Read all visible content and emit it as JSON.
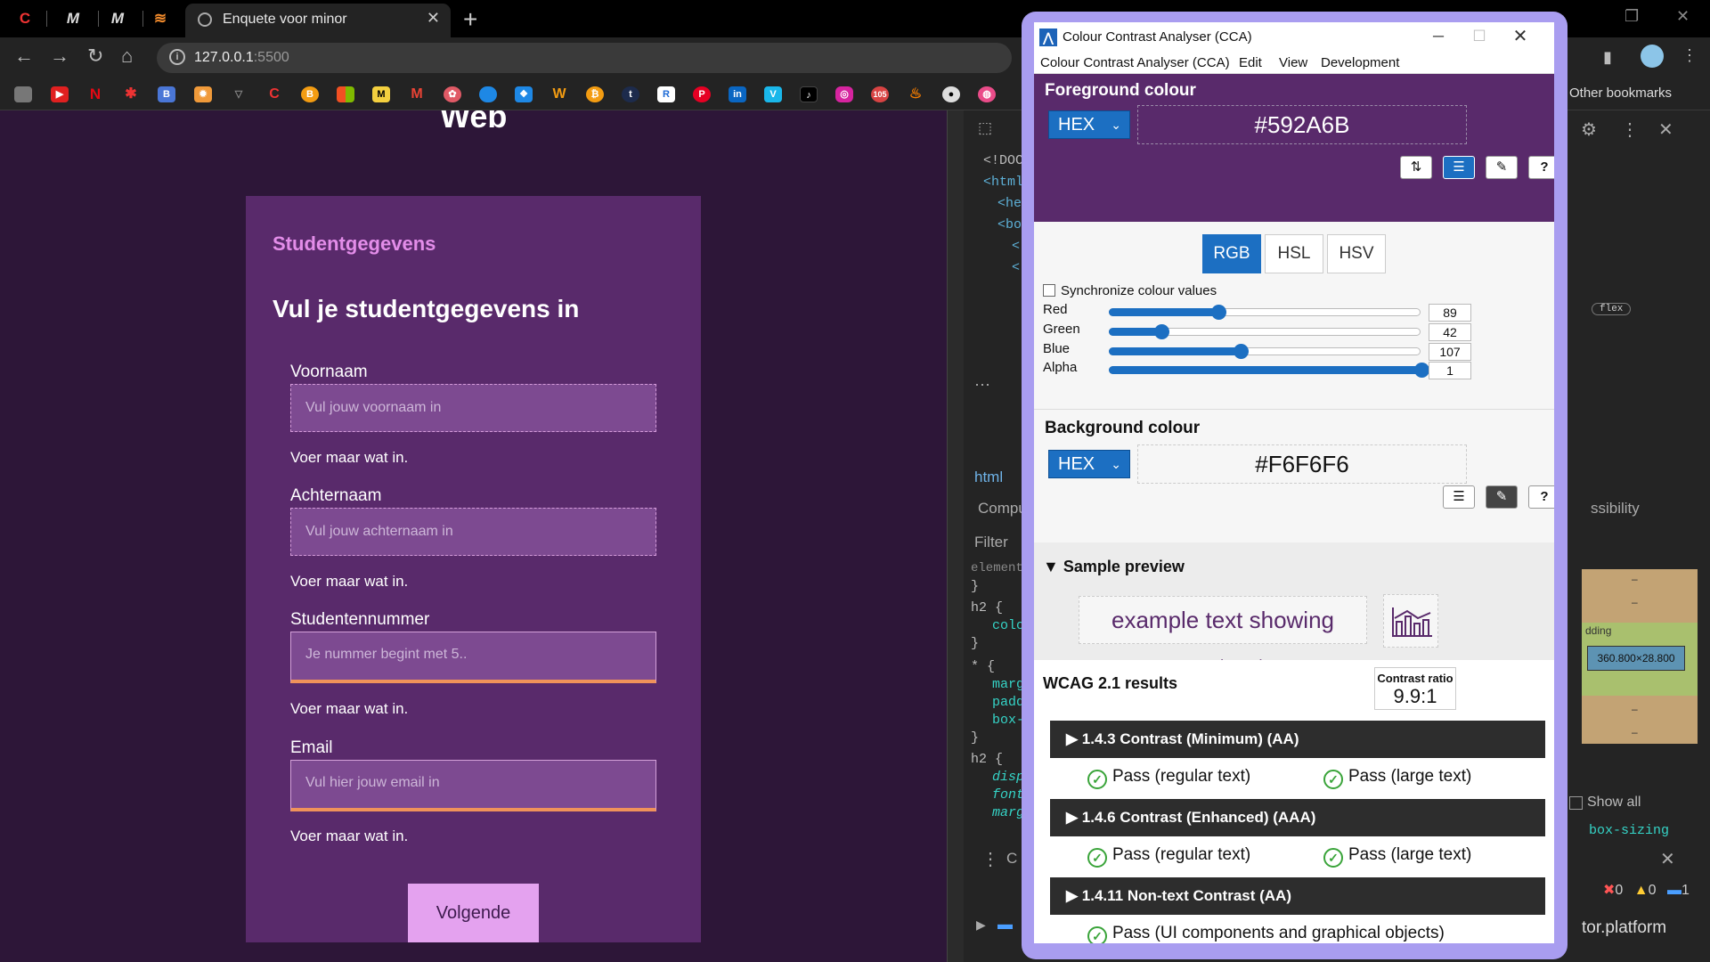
{
  "browser": {
    "mini_tabs": [
      "M",
      "M"
    ],
    "active_tab_title": "Enquete voor minor",
    "close_glyph": "✕",
    "new_tab_glyph": "+",
    "url_host": "127.0.0.1",
    "url_port": ":5500",
    "other_bookmarks": "Other bookmarks"
  },
  "page": {
    "heading_fragment": "Web",
    "section_label": "Studentgegevens",
    "form_title": "Vul je studentgegevens in",
    "fields": [
      {
        "label": "Voornaam",
        "placeholder": "Vul jouw voornaam in",
        "hint": "Voer maar wat in."
      },
      {
        "label": "Achternaam",
        "placeholder": "Vul jouw achternaam  in",
        "hint": "Voer maar wat in."
      },
      {
        "label": "Studentennummer",
        "placeholder": "Je nummer begint met 5..",
        "hint": "Voer maar wat in."
      },
      {
        "label": "Email",
        "placeholder": "Vul hier jouw email in",
        "hint": "Voer maar wat in."
      }
    ],
    "next_button": "Volgende"
  },
  "devtools": {
    "elements_lines": [
      "<!DOC",
      "<html",
      "<he",
      "<bo",
      "<",
      "<"
    ],
    "breadcrumb": "html",
    "flex_badge": "flex",
    "computed_tab": "Compu",
    "filter": "Filter",
    "styles_lines": [
      "element",
      "}",
      "h2 {",
      "colo",
      "}",
      "* {",
      "marg",
      "padd",
      "box-",
      "}",
      "h2 {",
      "disp",
      "font",
      "marg"
    ],
    "accessibility_tab": "ssibility",
    "box_padding_label": "dding",
    "box_content_size": "360.800×28.800",
    "box_dash": "–",
    "show_all": "Show all",
    "box_sizing": "box-sizing",
    "console_fragment": "C",
    "errors": "0",
    "warnings": "0",
    "messages": "1",
    "platform_text": "tor.platform"
  },
  "cca": {
    "title": "Colour Contrast Analyser (CCA)",
    "menu": [
      "Colour Contrast Analyser (CCA)",
      "Edit",
      "View",
      "Development"
    ],
    "foreground": {
      "title": "Foreground colour",
      "format": "HEX",
      "hex": "#592A6B"
    },
    "models": [
      "RGB",
      "HSL",
      "HSV"
    ],
    "active_model": "RGB",
    "sync_label": "Synchronize colour values",
    "channels": [
      {
        "name": "Red",
        "value": 89,
        "max": 255
      },
      {
        "name": "Green",
        "value": 42,
        "max": 255
      },
      {
        "name": "Blue",
        "value": 107,
        "max": 255
      },
      {
        "name": "Alpha",
        "value": 1,
        "max": 1
      }
    ],
    "background": {
      "title": "Background colour",
      "format": "HEX",
      "hex": "#F6F6F6"
    },
    "sample_preview_title": "Sample preview",
    "sample_text": "example text showing contrast",
    "results_title": "WCAG 2.1 results",
    "contrast_ratio_label": "Contrast ratio",
    "contrast_ratio": "9.9:1",
    "criteria": [
      {
        "title": "1.4.3 Contrast (Minimum) (AA)",
        "results": [
          "Pass (regular text)",
          "Pass (large text)"
        ]
      },
      {
        "title": "1.4.6 Contrast (Enhanced) (AAA)",
        "results": [
          "Pass (regular text)",
          "Pass (large text)"
        ]
      },
      {
        "title": "1.4.11 Non-text Contrast (AA)",
        "results": [
          "Pass (UI components and graphical objects)"
        ]
      }
    ]
  },
  "colors": {
    "page_bg": "#2d1638",
    "card_bg": "#592a6b",
    "accent_pink": "#e38de9",
    "cca_blue": "#1c6fc2",
    "pass_green": "#3aa43a"
  }
}
